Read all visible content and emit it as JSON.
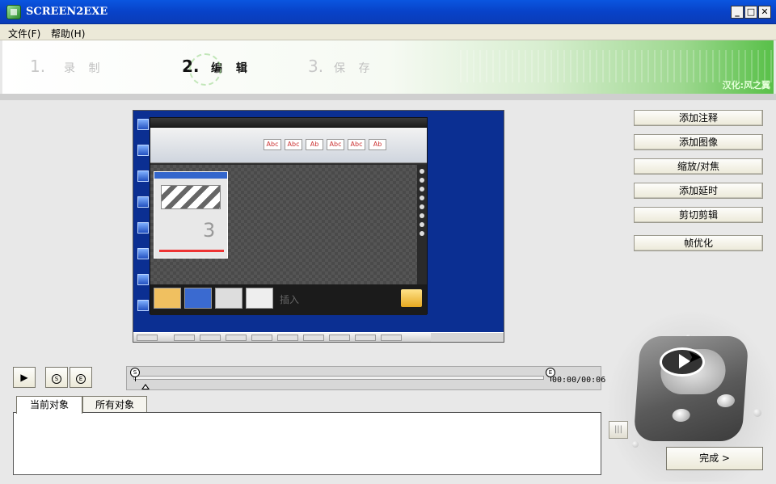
{
  "window": {
    "title": "SCREEN2EXE",
    "min": "_",
    "max": "□",
    "close": "✕"
  },
  "menu": [
    {
      "label": "文件(F)"
    },
    {
      "label": "帮助(H)"
    }
  ],
  "steps": [
    {
      "num": "1.",
      "label": "录 制"
    },
    {
      "num": "2.",
      "label": "编 辑"
    },
    {
      "num": "3.",
      "label": "保 存"
    }
  ],
  "banner": {
    "brand": "汉化:风之翼"
  },
  "side_buttons": [
    {
      "label": "添加注释"
    },
    {
      "label": "添加图像"
    },
    {
      "label": "缩放/对焦"
    },
    {
      "label": "添加延时"
    },
    {
      "label": "剪切剪辑"
    },
    {
      "label": "帧优化"
    }
  ],
  "preview": {
    "ribbon_swatches": [
      "Abc",
      "Abc",
      "Ab",
      "Abc",
      "Abc",
      "Ab"
    ],
    "card_number": "3",
    "thumb_text": "插入"
  },
  "controls": {
    "play": "▶",
    "marker_start": "S",
    "marker_end": "E"
  },
  "timeline": {
    "start_marker": "S",
    "end_marker": "E",
    "timecode": "00:00/00:06"
  },
  "tabs": [
    {
      "label": "当前对象"
    },
    {
      "label": "所有对象"
    }
  ],
  "small_button": "|||",
  "finish_button": "完成 >",
  "colors": {
    "titlebar": "#0842c8",
    "accent_green": "#58c048"
  }
}
